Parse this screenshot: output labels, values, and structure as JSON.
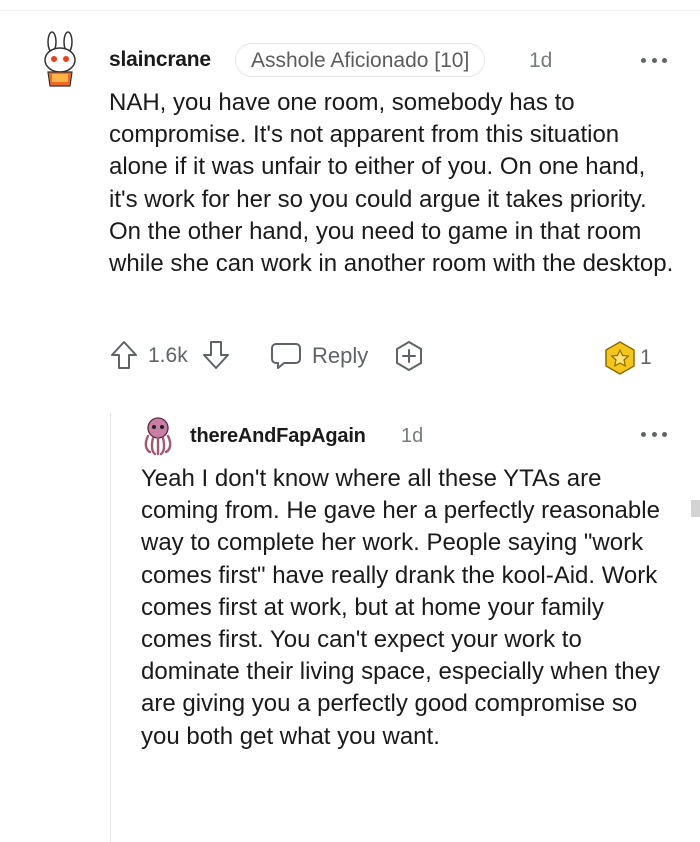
{
  "comment": {
    "username": "slaincrane",
    "flair": "Asshole Aficionado [10]",
    "time": "1d",
    "body": "NAH, you have one room, somebody has to compromise. It's not apparent from this situation alone if it was unfair to either of you. On one hand, it's work for her so you could argue it takes priority. On the other hand, you need to game in that room while she can work in another room with the desktop.",
    "score": "1.6k",
    "reply_label": "Reply",
    "award_count": "1"
  },
  "reply": {
    "username": "thereAndFapAgain",
    "time": "1d",
    "body": "Yeah I don't know where all these YTAs are coming from. He gave her a perfectly reasonable way to complete her work. People saying \"work comes first\" have really drank the kool-Aid. Work comes first at work, but at home your family comes first. You can't expect your work to dominate their living space, especially when they are giving you a perfectly good compromise so you both get what you want."
  },
  "icons": {
    "avatar1": "snoo-bunny-avatar",
    "avatar2": "snoo-octopus-avatar",
    "upvote": "upvote-arrow-icon",
    "downvote": "downvote-arrow-icon",
    "reply": "chat-bubble-icon",
    "award": "add-award-icon",
    "award_badge": "gold-award-icon",
    "more": "more-options-icon"
  },
  "colors": {
    "text": "#1a1a1b",
    "meta": "#787c7e",
    "action": "#5f6368",
    "award_gold": "#f5c518"
  }
}
